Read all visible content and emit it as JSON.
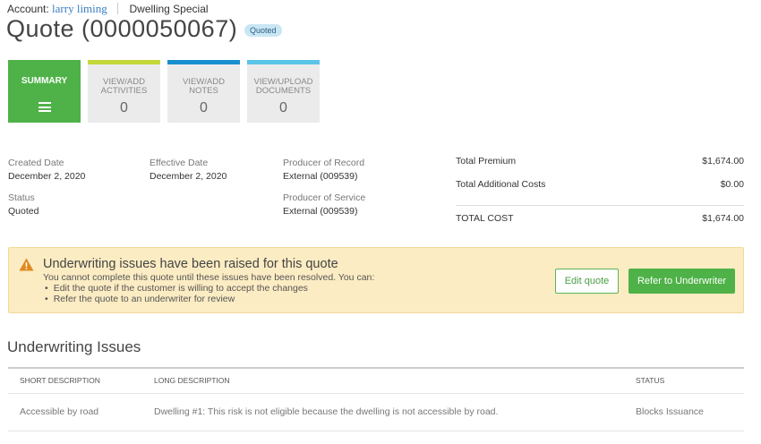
{
  "account": {
    "label": "Account:",
    "name": "larry liming",
    "product": "Dwelling Special"
  },
  "quote": {
    "title": "Quote (0000050067)",
    "status_badge": "Quoted"
  },
  "tiles": [
    {
      "label": "SUMMARY",
      "count": "",
      "color": "#4fb248",
      "icon": "menu-icon"
    },
    {
      "label": "VIEW/ADD ACTIVITIES",
      "count": "0",
      "color": "#c4d83b"
    },
    {
      "label": "VIEW/ADD NOTES",
      "count": "0",
      "color": "#1a8fcf"
    },
    {
      "label": "VIEW/UPLOAD DOCUMENTS",
      "count": "0",
      "color": "#5bc5e8"
    }
  ],
  "details": {
    "created_date_label": "Created Date",
    "created_date": "December 2, 2020",
    "status_label": "Status",
    "status": "Quoted",
    "effective_date_label": "Effective Date",
    "effective_date": "December 2, 2020",
    "producer_record_label": "Producer of Record",
    "producer_record": "External (009539)",
    "producer_service_label": "Producer of Service",
    "producer_service": "External (009539)"
  },
  "totals": {
    "premium_label": "Total Premium",
    "premium": "$1,674.00",
    "additional_label": "Total Additional Costs",
    "additional": "$0.00",
    "total_label": "TOTAL COST",
    "total": "$1,674.00"
  },
  "alert": {
    "icon": "warning-icon",
    "title": "Underwriting issues have been raised for this quote",
    "text": "You cannot complete this quote until these issues have been resolved. You can:",
    "bullets": [
      "Edit the quote if the customer is willing to accept the changes",
      "Refer the quote to an underwriter for review"
    ],
    "edit_label": "Edit quote",
    "refer_label": "Refer to Underwriter"
  },
  "issues": {
    "title": "Underwriting Issues",
    "columns": [
      "SHORT DESCRIPTION",
      "LONG DESCRIPTION",
      "STATUS"
    ],
    "rows": [
      [
        "Accessible by road",
        "Dwelling #1: This risk is not eligible because the dwelling is not accessible by road.",
        "Blocks Issuance"
      ]
    ]
  }
}
